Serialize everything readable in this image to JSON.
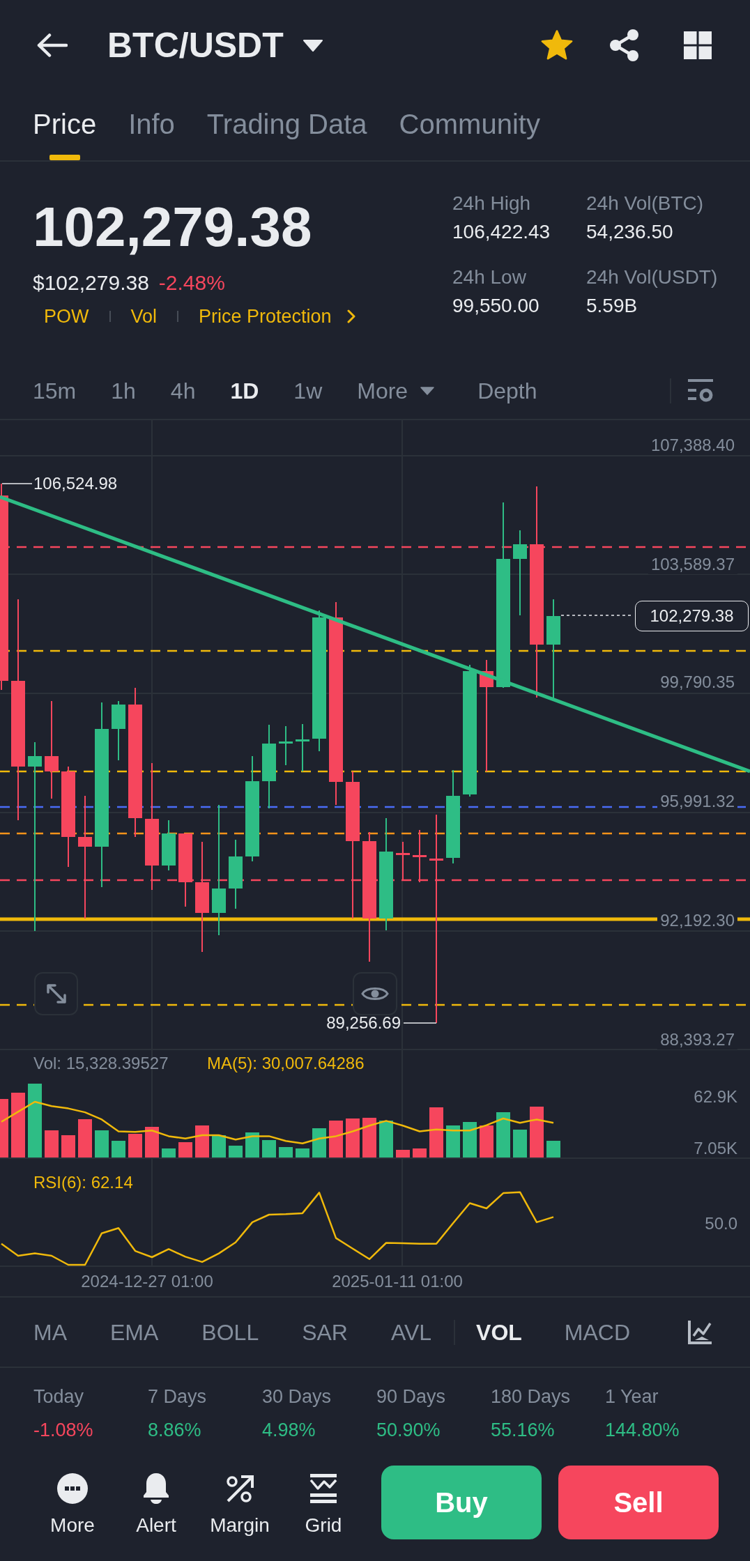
{
  "header": {
    "title": "BTC/USDT",
    "favorite": true
  },
  "tabs": [
    {
      "label": "Price",
      "selected": true
    },
    {
      "label": "Info",
      "selected": false
    },
    {
      "label": "Trading Data",
      "selected": false
    },
    {
      "label": "Community",
      "selected": false
    }
  ],
  "ticker": {
    "last_price": "102,279.38",
    "usd_price": "$102,279.38",
    "change": "-2.48%",
    "tags": [
      "POW",
      "Vol"
    ],
    "price_protection": "Price Protection"
  },
  "stats": [
    {
      "label": "24h High",
      "value": "106,422.43"
    },
    {
      "label": "24h Vol(BTC)",
      "value": "54,236.50"
    },
    {
      "label": "24h Low",
      "value": "99,550.00"
    },
    {
      "label": "24h Vol(USDT)",
      "value": "5.59B"
    }
  ],
  "intervals": [
    {
      "label": "15m",
      "selected": false
    },
    {
      "label": "1h",
      "selected": false
    },
    {
      "label": "4h",
      "selected": false
    },
    {
      "label": "1D",
      "selected": true
    },
    {
      "label": "1w",
      "selected": false
    }
  ],
  "more_menu": {
    "label": "More"
  },
  "depth_tab": {
    "label": "Depth",
    "selected": false
  },
  "price_chart": {
    "axis_labels": [
      "107,388.40",
      "103,589.37",
      "99,790.35",
      "95,991.32",
      "92,192.30",
      "88,393.27"
    ],
    "high_label": "106,524.98",
    "low_label": "89,256.69",
    "last_price_label": "102,279.38"
  },
  "volume": {
    "reading": "Vol: 15,328.39527",
    "ma_reading": "MA(5): 30,007.64286",
    "axis_labels": [
      "62.9K",
      "7.05K"
    ]
  },
  "rsi": {
    "reading": "RSI(6): 62.14",
    "axis_label": "50.0"
  },
  "time_labels": [
    "2024-12-27 01:00",
    "2025-01-11 01:00"
  ],
  "indicators": {
    "main": [
      {
        "label": "MA",
        "selected": false
      },
      {
        "label": "EMA",
        "selected": false
      },
      {
        "label": "BOLL",
        "selected": false
      },
      {
        "label": "SAR",
        "selected": false
      },
      {
        "label": "AVL",
        "selected": false
      }
    ],
    "sub": [
      {
        "label": "VOL",
        "selected": true
      },
      {
        "label": "MACD",
        "selected": false
      }
    ]
  },
  "performance": [
    {
      "label": "Today",
      "value": "-1.08%",
      "color": "#f6465d"
    },
    {
      "label": "7 Days",
      "value": "8.86%",
      "color": "#2ebd85"
    },
    {
      "label": "30 Days",
      "value": "4.98%",
      "color": "#2ebd85"
    },
    {
      "label": "90 Days",
      "value": "50.90%",
      "color": "#2ebd85"
    },
    {
      "label": "180 Days",
      "value": "55.16%",
      "color": "#2ebd85"
    },
    {
      "label": "1 Year",
      "value": "144.80%",
      "color": "#2ebd85"
    }
  ],
  "actions": [
    "More",
    "Alert",
    "Margin",
    "Grid"
  ],
  "trade_buttons": [
    {
      "label": "Buy",
      "kind": "buy"
    },
    {
      "label": "Sell",
      "kind": "sell"
    }
  ]
}
